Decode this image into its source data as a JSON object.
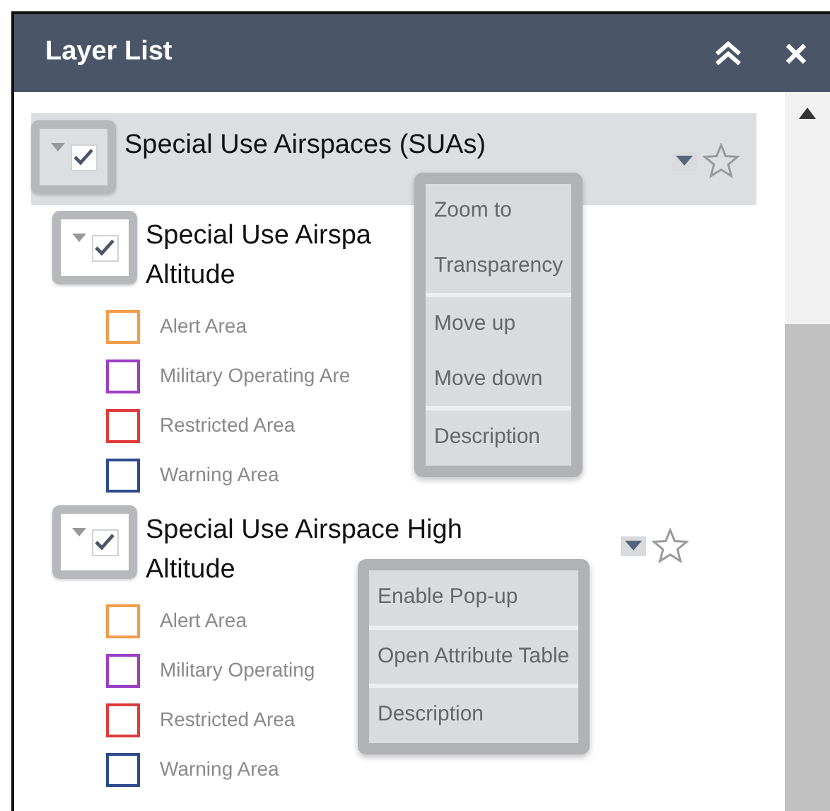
{
  "panel": {
    "title": "Layer List"
  },
  "layers": [
    {
      "label_lines": [
        "Special Use Airspaces (SUAs)"
      ],
      "checked": true,
      "expanded": true,
      "selected": true,
      "show_actions": true,
      "menu": {
        "groups": [
          [
            "Zoom to",
            "Transparency"
          ],
          [
            "Move up",
            "Move down"
          ],
          [
            "Description"
          ]
        ]
      },
      "children": [
        {
          "label_lines": [
            "Special Use Airspa",
            "Altitude"
          ],
          "checked": true,
          "expanded": true,
          "selected": false,
          "legend": [
            {
              "label": "Alert Area",
              "color": "#f39c4a"
            },
            {
              "label": "Military Operating Are",
              "color": "#9b3fc4"
            },
            {
              "label": "Restricted Area",
              "color": "#e03b3b"
            },
            {
              "label": "Warning Area",
              "color": "#2f4b8c"
            }
          ]
        },
        {
          "label_lines": [
            "Special Use Airspace High",
            "Altitude"
          ],
          "checked": true,
          "expanded": true,
          "selected": false,
          "show_actions": true,
          "menu": {
            "groups": [
              [
                "Enable Pop-up"
              ],
              [
                "Open Attribute Table"
              ],
              [
                "Description"
              ]
            ]
          },
          "legend": [
            {
              "label": "Alert Area",
              "color": "#f39c4a"
            },
            {
              "label": "Military Operating",
              "color": "#9b3fc4"
            },
            {
              "label": "Restricted Area",
              "color": "#e03b3b"
            },
            {
              "label": "Warning Area",
              "color": "#2f4b8c"
            }
          ]
        }
      ]
    }
  ]
}
